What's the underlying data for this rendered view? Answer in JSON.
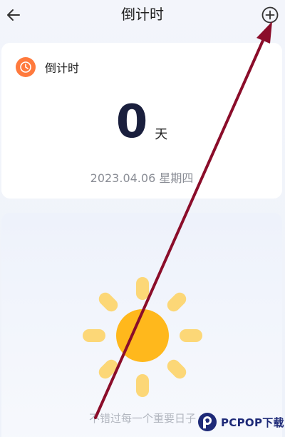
{
  "header": {
    "title": "倒计时",
    "back_icon": "arrow-left-icon",
    "add_icon": "plus-circle-icon"
  },
  "card": {
    "label": "倒计时",
    "icon": "clock-icon",
    "count": "0",
    "unit": "天",
    "date": "2023.04.06 星期四"
  },
  "empty_state": {
    "tagline": "不错过每一个重要日子",
    "illustration": "sun-icon"
  },
  "watermark": {
    "text": "PCPOP下载"
  },
  "colors": {
    "accent_orange": "#ff7a3d",
    "sun_core": "#ffb81c",
    "sun_rays": "#fcd777",
    "arrow": "#8b0d2a",
    "count_text": "#1a1f3d"
  }
}
